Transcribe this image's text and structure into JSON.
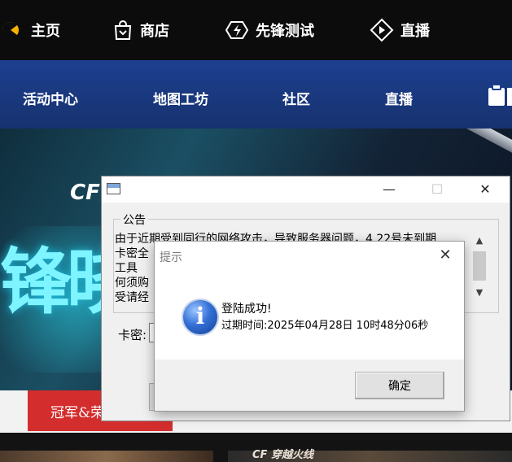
{
  "topnav": {
    "items": [
      {
        "label": "主页",
        "icon": "pacman-logo-icon"
      },
      {
        "label": "商店",
        "icon": "shopping-bag-icon"
      },
      {
        "label": "先锋测试",
        "icon": "lightning-badge-icon"
      },
      {
        "label": "直播",
        "icon": "play-diamond-icon"
      }
    ]
  },
  "subnav": {
    "items": [
      "活动中心",
      "地图工坊",
      "社区",
      "直播"
    ]
  },
  "banner": {
    "logo_text": "CF",
    "big_text": "锋晓",
    "champion_label": "冠军&荣",
    "bottom_thumb_text": "CF 穿越火线"
  },
  "main_window": {
    "group_label": "公告",
    "notice_lines": [
      "由于近期受到同行的网络攻击，导致服务器问题，4.22号未到期",
      "卡密全",
      "工具",
      "何须购",
      "受请经"
    ],
    "card_label": "卡密:",
    "minimize": "—",
    "maximize": "☐",
    "close": "✕"
  },
  "dialog": {
    "title": "提示",
    "close": "✕",
    "message_line1": "登陆成功!",
    "message_line2": "过期时间:2025年04月28日 10时48分06秒",
    "ok_label": "确定"
  },
  "colors": {
    "topbar_bg": "#0c0c0c",
    "subnav_bg": "#1c3f8f",
    "accent_red": "#d42d2d",
    "cyan_text": "#7df4ff"
  }
}
